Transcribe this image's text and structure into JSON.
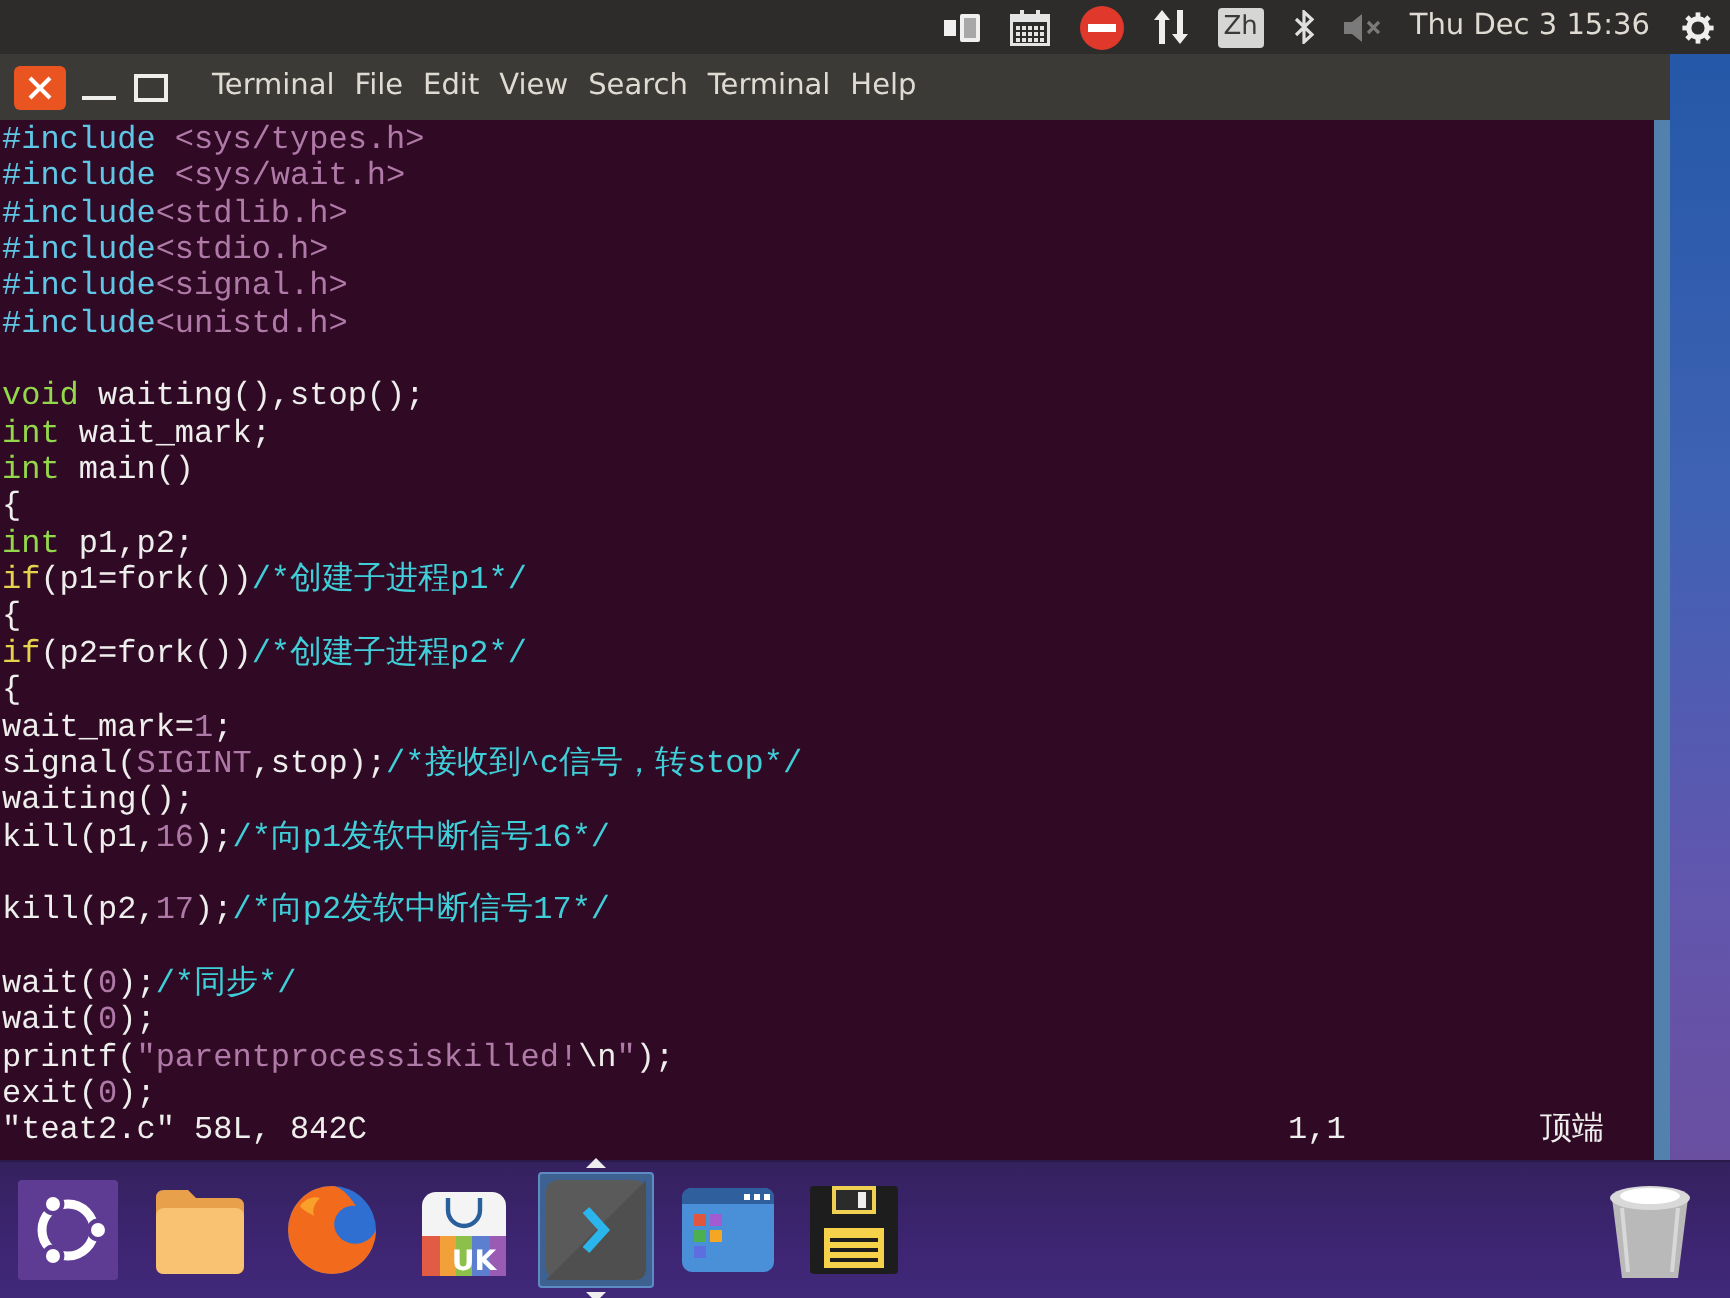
{
  "top_panel": {
    "items": [
      {
        "kind": "battery"
      },
      {
        "kind": "calendar"
      },
      {
        "kind": "no_entry"
      },
      {
        "kind": "network"
      },
      {
        "kind": "input_method",
        "label": "Zh"
      },
      {
        "kind": "bluetooth"
      },
      {
        "kind": "muted_speaker"
      },
      {
        "kind": "clock",
        "text": "Thu Dec 3 15:36"
      },
      {
        "kind": "gear"
      }
    ]
  },
  "window": {
    "controls": [
      {
        "kind": "close"
      },
      {
        "kind": "minimize"
      },
      {
        "kind": "maximize"
      }
    ],
    "title": "Terminal",
    "menu": [
      "File",
      "Edit",
      "View",
      "Search",
      "Terminal",
      "Help"
    ]
  },
  "editor": {
    "lines": [
      {
        "kind": "code",
        "segments": [
          {
            "kind": "preproc",
            "text": "#include"
          },
          {
            "kind": "include",
            "text": " <sys/types.h>"
          }
        ]
      },
      {
        "kind": "code",
        "segments": [
          {
            "kind": "preproc",
            "text": "#include"
          },
          {
            "kind": "include",
            "text": " <sys/wait.h>"
          }
        ]
      },
      {
        "kind": "code",
        "segments": [
          {
            "kind": "preproc",
            "text": "#include"
          },
          {
            "kind": "include",
            "text": "<stdlib.h>"
          }
        ]
      },
      {
        "kind": "code",
        "segments": [
          {
            "kind": "preproc",
            "text": "#include"
          },
          {
            "kind": "include",
            "text": "<stdio.h>"
          }
        ]
      },
      {
        "kind": "code",
        "segments": [
          {
            "kind": "preproc",
            "text": "#include"
          },
          {
            "kind": "include",
            "text": "<signal.h>"
          }
        ]
      },
      {
        "kind": "code",
        "segments": [
          {
            "kind": "preproc",
            "text": "#include"
          },
          {
            "kind": "include",
            "text": "<unistd.h>"
          }
        ]
      },
      {
        "kind": "blank"
      },
      {
        "kind": "code",
        "segments": [
          {
            "kind": "type",
            "text": "void"
          },
          {
            "kind": "plain",
            "text": " waiting(),stop();"
          }
        ]
      },
      {
        "kind": "code",
        "segments": [
          {
            "kind": "type",
            "text": "int"
          },
          {
            "kind": "plain",
            "text": " wait_mark;"
          }
        ]
      },
      {
        "kind": "code",
        "segments": [
          {
            "kind": "type",
            "text": "int"
          },
          {
            "kind": "plain",
            "text": " main()"
          }
        ]
      },
      {
        "kind": "code",
        "segments": [
          {
            "kind": "plain",
            "text": "{"
          }
        ]
      },
      {
        "kind": "code",
        "segments": [
          {
            "kind": "type",
            "text": "int"
          },
          {
            "kind": "plain",
            "text": " p1,p2;"
          }
        ]
      },
      {
        "kind": "code",
        "segments": [
          {
            "kind": "keyword",
            "text": "if"
          },
          {
            "kind": "plain",
            "text": "(p1=fork())"
          },
          {
            "kind": "comment",
            "text": "/*创建子进程p1*/"
          }
        ]
      },
      {
        "kind": "code",
        "segments": [
          {
            "kind": "plain",
            "text": "{"
          }
        ]
      },
      {
        "kind": "code",
        "segments": [
          {
            "kind": "keyword",
            "text": "if"
          },
          {
            "kind": "plain",
            "text": "(p2=fork())"
          },
          {
            "kind": "comment",
            "text": "/*创建子进程p2*/"
          }
        ]
      },
      {
        "kind": "code",
        "segments": [
          {
            "kind": "plain",
            "text": "{"
          }
        ]
      },
      {
        "kind": "code",
        "segments": [
          {
            "kind": "plain",
            "text": "wait_mark="
          },
          {
            "kind": "number",
            "text": "1"
          },
          {
            "kind": "plain",
            "text": ";"
          }
        ]
      },
      {
        "kind": "code",
        "segments": [
          {
            "kind": "plain",
            "text": "signal("
          },
          {
            "kind": "constant",
            "text": "SIGINT"
          },
          {
            "kind": "plain",
            "text": ",stop);"
          },
          {
            "kind": "comment",
            "text": "/*接收到^c信号，转stop*/"
          }
        ]
      },
      {
        "kind": "code",
        "segments": [
          {
            "kind": "plain",
            "text": "waiting();"
          }
        ]
      },
      {
        "kind": "code",
        "segments": [
          {
            "kind": "plain",
            "text": "kill(p1,"
          },
          {
            "kind": "number",
            "text": "16"
          },
          {
            "kind": "plain",
            "text": ");"
          },
          {
            "kind": "comment",
            "text": "/*向p1发软中断信号16*/"
          }
        ]
      },
      {
        "kind": "blank"
      },
      {
        "kind": "code",
        "segments": [
          {
            "kind": "plain",
            "text": "kill(p2,"
          },
          {
            "kind": "number",
            "text": "17"
          },
          {
            "kind": "plain",
            "text": ");"
          },
          {
            "kind": "comment",
            "text": "/*向p2发软中断信号17*/"
          }
        ]
      },
      {
        "kind": "blank"
      },
      {
        "kind": "code",
        "segments": [
          {
            "kind": "plain",
            "text": "wait("
          },
          {
            "kind": "number",
            "text": "0"
          },
          {
            "kind": "plain",
            "text": ");"
          },
          {
            "kind": "comment",
            "text": "/*同步*/"
          }
        ]
      },
      {
        "kind": "code",
        "segments": [
          {
            "kind": "plain",
            "text": "wait("
          },
          {
            "kind": "number",
            "text": "0"
          },
          {
            "kind": "plain",
            "text": ");"
          }
        ]
      },
      {
        "kind": "code",
        "segments": [
          {
            "kind": "plain",
            "text": "printf("
          },
          {
            "kind": "string",
            "text": "\"parentprocessiskilled!"
          },
          {
            "kind": "special",
            "text": "\\n"
          },
          {
            "kind": "string",
            "text": "\""
          },
          {
            "kind": "plain",
            "text": ");"
          }
        ]
      },
      {
        "kind": "code",
        "segments": [
          {
            "kind": "plain",
            "text": "exit("
          },
          {
            "kind": "number",
            "text": "0"
          },
          {
            "kind": "plain",
            "text": ");"
          }
        ]
      }
    ],
    "status_line": {
      "file_info": "\"teat2.c\" 58L, 842C",
      "cursor": "1,1",
      "position": "顶端"
    }
  },
  "launcher": {
    "items": [
      {
        "kind": "dash",
        "selected": false
      },
      {
        "kind": "files",
        "selected": false
      },
      {
        "kind": "browser",
        "selected": false
      },
      {
        "kind": "store",
        "label": "UK",
        "selected": false
      },
      {
        "kind": "terminal",
        "selected": true
      },
      {
        "kind": "app_window",
        "selected": false
      },
      {
        "kind": "save",
        "selected": false
      },
      {
        "kind": "trash",
        "selected": false
      }
    ]
  }
}
